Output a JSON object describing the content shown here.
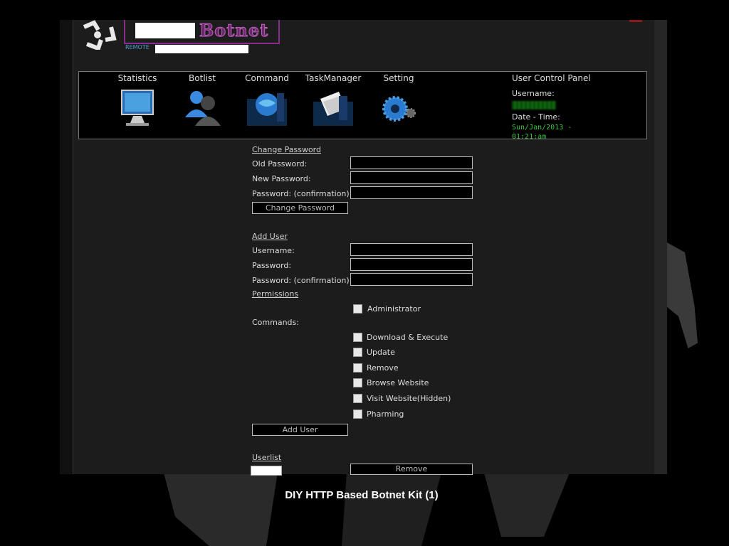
{
  "header": {
    "brand": "Botnet",
    "remote_label": "REMOTE"
  },
  "nav": {
    "items": [
      {
        "label": "Statistics",
        "icon": "monitor-icon"
      },
      {
        "label": "Botlist",
        "icon": "users-icon"
      },
      {
        "label": "Command",
        "icon": "globe-icon"
      },
      {
        "label": "TaskManager",
        "icon": "documents-icon"
      },
      {
        "label": "Setting",
        "icon": "gear-icon"
      }
    ],
    "user_panel": {
      "title": "User Control Panel",
      "username_label": "Username:",
      "datetime_label": "Date - Time:",
      "date_line1": "Sun/Jan/2013 -",
      "date_line2": "01:21:am"
    }
  },
  "change_password": {
    "title": "Change Password",
    "old_label": "Old Password:",
    "new_label": "New Password:",
    "confirm_label": "Password: (confirmation)",
    "button": "Change Password"
  },
  "add_user": {
    "title": "Add User",
    "username_label": "Username:",
    "password_label": "Password:",
    "confirm_label": "Password: (confirmation)",
    "permissions_title": "Permissions",
    "administrator": "Administrator",
    "commands_label": "Commands:",
    "commands": [
      "Download & Execute",
      "Update",
      "Remove",
      "Browse Website",
      "Visit Website(Hidden)",
      "Pharming"
    ],
    "button": "Add User"
  },
  "userlist": {
    "title": "Userlist",
    "remove_button": "Remove"
  },
  "caption": "DIY HTTP Based Botnet Kit (1)",
  "colors": {
    "brand_purple": "#8a2a8a",
    "datetime_green": "#3ec43e",
    "background": "#1c1c1c"
  }
}
